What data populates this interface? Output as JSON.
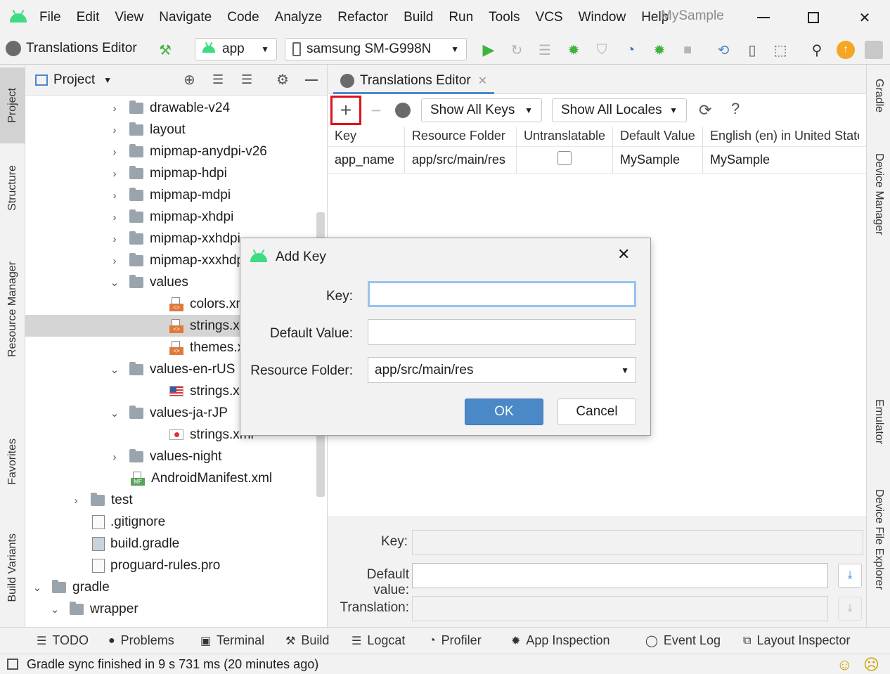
{
  "window": {
    "title": "MySample",
    "menu": [
      "File",
      "Edit",
      "View",
      "Navigate",
      "Code",
      "Analyze",
      "Refactor",
      "Build",
      "Run",
      "Tools",
      "VCS",
      "Window",
      "Help"
    ]
  },
  "toolbar": {
    "breadcrumb": "Translations Editor",
    "run_config": "app",
    "device": "samsung SM-G998N"
  },
  "left_strip": [
    "Project",
    "Structure",
    "Resource Manager",
    "Favorites",
    "Build Variants"
  ],
  "right_strip": [
    "Gradle",
    "Device Manager",
    "Emulator",
    "Device File Explorer"
  ],
  "project_panel": {
    "view_selector": "Project",
    "tree": [
      {
        "label": "drawable-v24",
        "kind": "folder",
        "expanded": false
      },
      {
        "label": "layout",
        "kind": "folder",
        "expanded": false
      },
      {
        "label": "mipmap-anydpi-v26",
        "kind": "folder",
        "expanded": false
      },
      {
        "label": "mipmap-hdpi",
        "kind": "folder",
        "expanded": false
      },
      {
        "label": "mipmap-mdpi",
        "kind": "folder",
        "expanded": false
      },
      {
        "label": "mipmap-xhdpi",
        "kind": "folder",
        "expanded": false
      },
      {
        "label": "mipmap-xxhdpi",
        "kind": "folder",
        "expanded": false
      },
      {
        "label": "mipmap-xxxhdpi",
        "kind": "folder",
        "expanded": false
      },
      {
        "label": "values",
        "kind": "folder",
        "expanded": true
      },
      {
        "label": "colors.xml",
        "kind": "xml"
      },
      {
        "label": "strings.xml",
        "kind": "xml",
        "selected": true
      },
      {
        "label": "themes.xml",
        "kind": "xml"
      },
      {
        "label": "values-en-rUS",
        "kind": "folder",
        "expanded": true
      },
      {
        "label": "strings.xml",
        "kind": "flag-us"
      },
      {
        "label": "values-ja-rJP",
        "kind": "folder",
        "expanded": true
      },
      {
        "label": "strings.xml",
        "kind": "flag-jp"
      },
      {
        "label": "values-night",
        "kind": "folder",
        "expanded": false
      },
      {
        "label": "AndroidManifest.xml",
        "kind": "manifest"
      },
      {
        "label": "test",
        "kind": "folder",
        "expanded": false
      },
      {
        "label": ".gitignore",
        "kind": "file"
      },
      {
        "label": "build.gradle",
        "kind": "gradle"
      },
      {
        "label": "proguard-rules.pro",
        "kind": "file"
      },
      {
        "label": "gradle",
        "kind": "folder",
        "expanded": true
      },
      {
        "label": "wrapper",
        "kind": "folder",
        "expanded": true
      }
    ]
  },
  "editor": {
    "tab_label": "Translations Editor",
    "key_filter": "Show All Keys",
    "locale_filter": "Show All Locales",
    "help": "?",
    "columns": [
      "Key",
      "Resource Folder",
      "Untranslatable",
      "Default Value",
      "English (en) in United States"
    ],
    "rows": [
      {
        "key": "app_name",
        "folder": "app/src/main/res",
        "untranslatable": false,
        "default": "MySample",
        "en": "MySample"
      }
    ],
    "bottom": {
      "key_label": "Key:",
      "default_label": "Default value:",
      "translation_label": "Translation:"
    }
  },
  "dialog": {
    "title": "Add Key",
    "key_label": "Key:",
    "key_value": "",
    "default_label": "Default Value:",
    "default_value": "",
    "folder_label": "Resource Folder:",
    "folder_value": "app/src/main/res",
    "ok": "OK",
    "cancel": "Cancel"
  },
  "tool_tabs": [
    "TODO",
    "Problems",
    "Terminal",
    "Build",
    "Logcat",
    "Profiler",
    "App Inspection",
    "Event Log",
    "Layout Inspector"
  ],
  "status": {
    "message": "Gradle sync finished in 9 s 731 ms (20 minutes ago)"
  },
  "colors": {
    "accent": "#4a88c7",
    "highlight": "#e0101c",
    "android": "#3ddc84",
    "run": "#3fb33f"
  }
}
